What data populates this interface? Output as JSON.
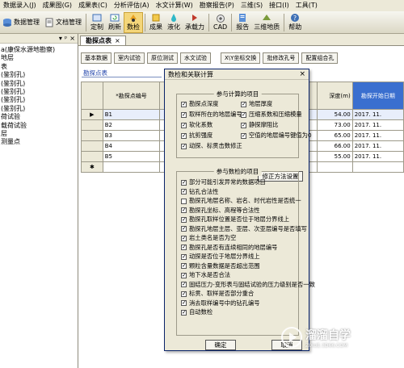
{
  "menubar": [
    "数据录入(J)",
    "成果图(G)",
    "成果表(C)",
    "分析评估(A)",
    "水文计算(W)",
    "勘察报告(P)",
    "三维(S)",
    "接口(I)",
    "工具(T)"
  ],
  "toolbar": {
    "data_mgmt": "数据管理",
    "doc_mgmt": "文档管理",
    "custom": "定制",
    "refresh": "刷新",
    "check": "数检",
    "result": "成果",
    "liquefy": "液化",
    "bearing": "承载力",
    "cad": "CAD",
    "report": "报告",
    "geo3d": "三维地质",
    "help": "帮助"
  },
  "leftpanel": {
    "controls": [
      "▾",
      "ᵖ",
      "×"
    ],
    "tree": [
      "a(康保水源地勘察)",
      "地层",
      "表",
      "(鉴别孔)",
      "(鉴别孔)",
      "(鉴别孔)",
      "(鉴别孔)",
      "(鉴别孔)",
      "荷试验",
      "载荷试验",
      "层",
      "测量点"
    ]
  },
  "doc": {
    "tab_label": "勘探点表",
    "tab_close": "×",
    "buttons": [
      "基本数据",
      "室内试验",
      "原位测试",
      "水文试验"
    ],
    "buttons_right": [
      "X\\Y坐标交换",
      "批修改孔号",
      "配置组合孔"
    ],
    "sheet_tab": "勘探点表"
  },
  "grid": {
    "headers": [
      "*勘探点编号",
      "",
      "深度(m)",
      "勘探开始日期"
    ],
    "rows": [
      {
        "indicator": "▶",
        "id": "B1",
        "mid": "",
        "depth": "54.00",
        "date": "2017. 11."
      },
      {
        "indicator": "",
        "id": "B2",
        "mid": "",
        "depth": "73.00",
        "date": "2017. 11."
      },
      {
        "indicator": "",
        "id": "B3",
        "mid": "",
        "depth": "65.00",
        "date": "2017. 11."
      },
      {
        "indicator": "",
        "id": "B4",
        "mid": "",
        "depth": "66.00",
        "date": "2017. 11."
      },
      {
        "indicator": "",
        "id": "B5",
        "mid": "",
        "depth": "55.00",
        "date": "2017. 11."
      },
      {
        "indicator": "✱",
        "id": "",
        "mid": "",
        "depth": "",
        "date": ""
      }
    ]
  },
  "dialog": {
    "title": "数检和关联计算",
    "close": "×",
    "group1_title": "参与计算的项目",
    "group1_left": [
      {
        "label": "勘探点深度",
        "checked": true
      },
      {
        "label": "取样所在的地层编号",
        "checked": true
      },
      {
        "label": "软化系数",
        "checked": true
      },
      {
        "label": "抗剪强度",
        "checked": true
      },
      {
        "label": "动探、标贯击数修正",
        "checked": true
      }
    ],
    "group1_right": [
      {
        "label": "地层厚度",
        "checked": true
      },
      {
        "label": "压缩系数和压缩模量",
        "checked": true
      },
      {
        "label": "静探摩阻比",
        "checked": true
      },
      {
        "label": "空值的地层编号键值为0",
        "checked": true
      }
    ],
    "fix_button": "修正方法设置",
    "group2_title": "参与数检的项目",
    "group2_items": [
      {
        "label": "部分可能引发异常的数据项目",
        "checked": true
      },
      {
        "label": "钻孔合法性",
        "checked": true
      },
      {
        "label": "勘探孔地层名称、岩名、时代岩性是否统一",
        "checked": false
      },
      {
        "label": "勘探孔坐标、高程等合法性",
        "checked": true
      },
      {
        "label": "勘探孔取样位置是否位于地层分界线上",
        "checked": true
      },
      {
        "label": "勘探孔地层主层、亚层、次亚层编号是否填写",
        "checked": true
      },
      {
        "label": "岩土类名是否为空",
        "checked": true
      },
      {
        "label": "勘探孔是否有连续相同的地层编号",
        "checked": true
      },
      {
        "label": "动探是否位于地层分界线上",
        "checked": true
      },
      {
        "label": "颗粒含量数据是否超出范围",
        "checked": true
      },
      {
        "label": "地下水是否合法",
        "checked": true
      },
      {
        "label": "固结压力-变形表与固结试验的压力级别是否一致",
        "checked": true
      },
      {
        "label": "标贯、取样是否部分重合",
        "checked": true
      },
      {
        "label": "消去取样编号中的钻孔编号",
        "checked": true
      }
    ],
    "auto_check": {
      "label": "自动数检",
      "checked": true
    },
    "ok": "确定",
    "cancel": "取消"
  },
  "watermark": {
    "big": "溜溜自学",
    "small": "ZIXUE.3D66.COM"
  }
}
